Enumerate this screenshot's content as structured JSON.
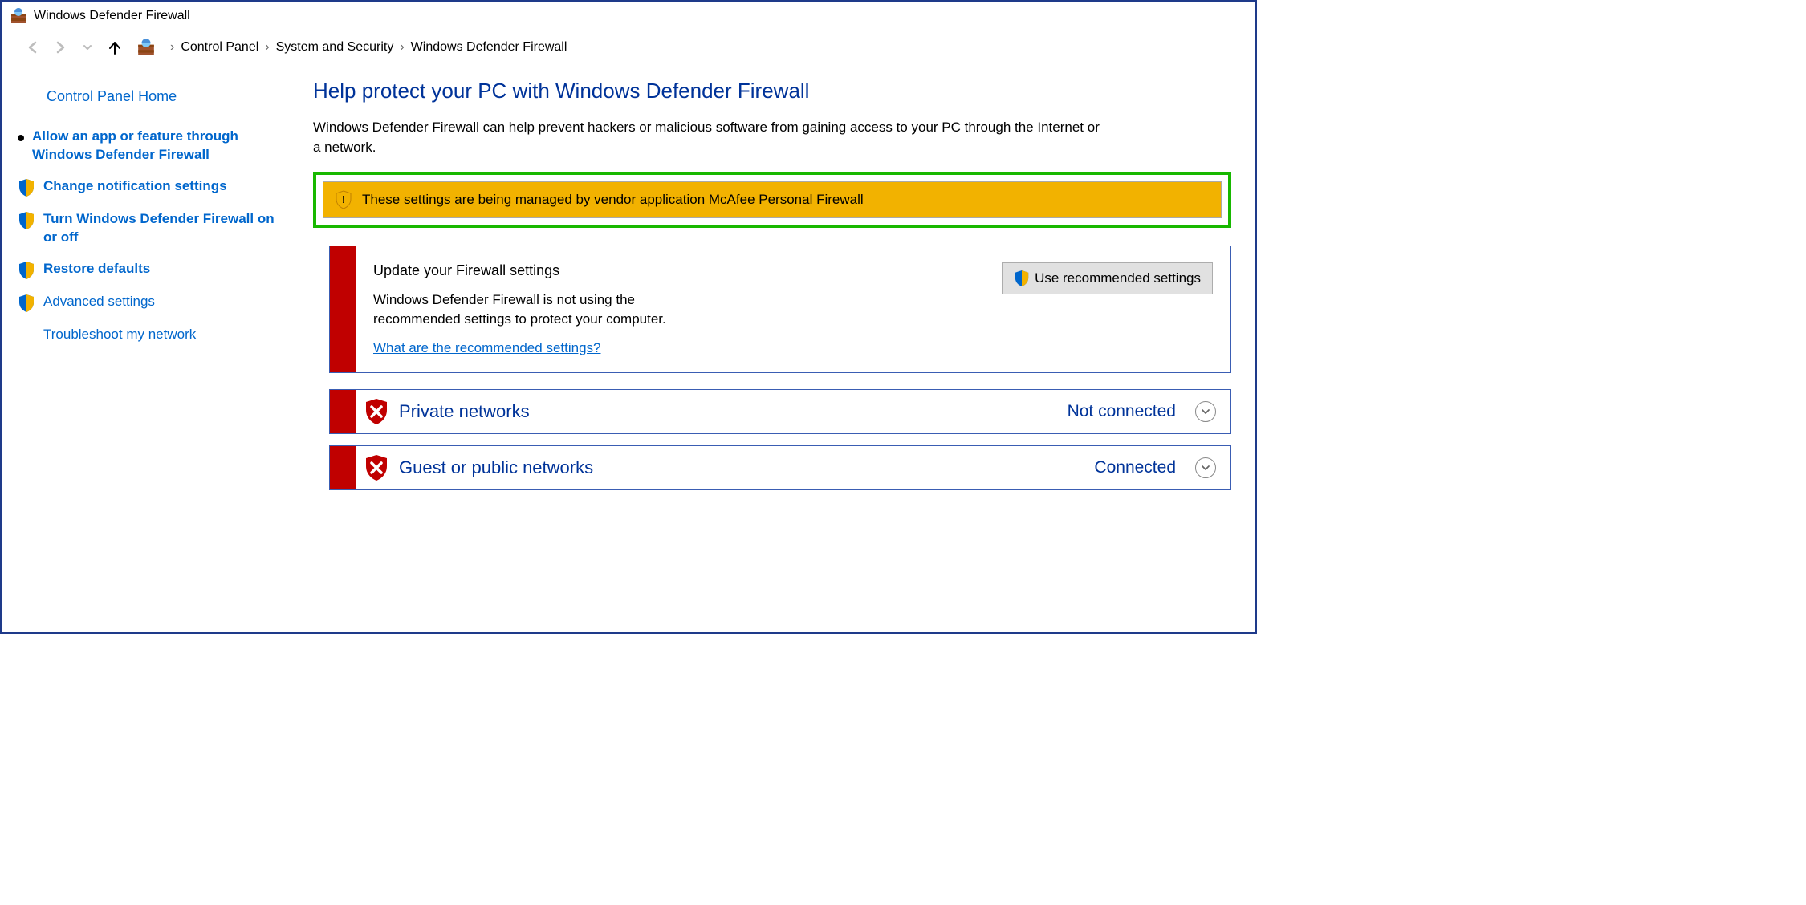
{
  "window": {
    "title": "Windows Defender Firewall"
  },
  "breadcrumb": {
    "items": [
      "Control Panel",
      "System and Security",
      "Windows Defender Firewall"
    ]
  },
  "sidebar": {
    "home": "Control Panel Home",
    "items": [
      {
        "label": "Allow an app or feature through Windows Defender Firewall"
      },
      {
        "label": "Change notification settings"
      },
      {
        "label": "Turn Windows Defender Firewall on or off"
      },
      {
        "label": "Restore defaults"
      },
      {
        "label": "Advanced settings"
      },
      {
        "label": "Troubleshoot my network"
      }
    ]
  },
  "main": {
    "heading": "Help protect your PC with Windows Defender Firewall",
    "description": "Windows Defender Firewall can help prevent hackers or malicious software from gaining access to your PC through the Internet or a network.",
    "alert": "These settings are being managed by vendor application McAfee Personal Firewall",
    "update_panel": {
      "title": "Update your Firewall settings",
      "text": "Windows Defender Firewall is not using the recommended settings to protect your computer.",
      "link": "What are the recommended settings?",
      "button": "Use recommended settings"
    },
    "networks": [
      {
        "name": "Private networks",
        "status": "Not connected"
      },
      {
        "name": "Guest or public networks",
        "status": "Connected"
      }
    ]
  }
}
